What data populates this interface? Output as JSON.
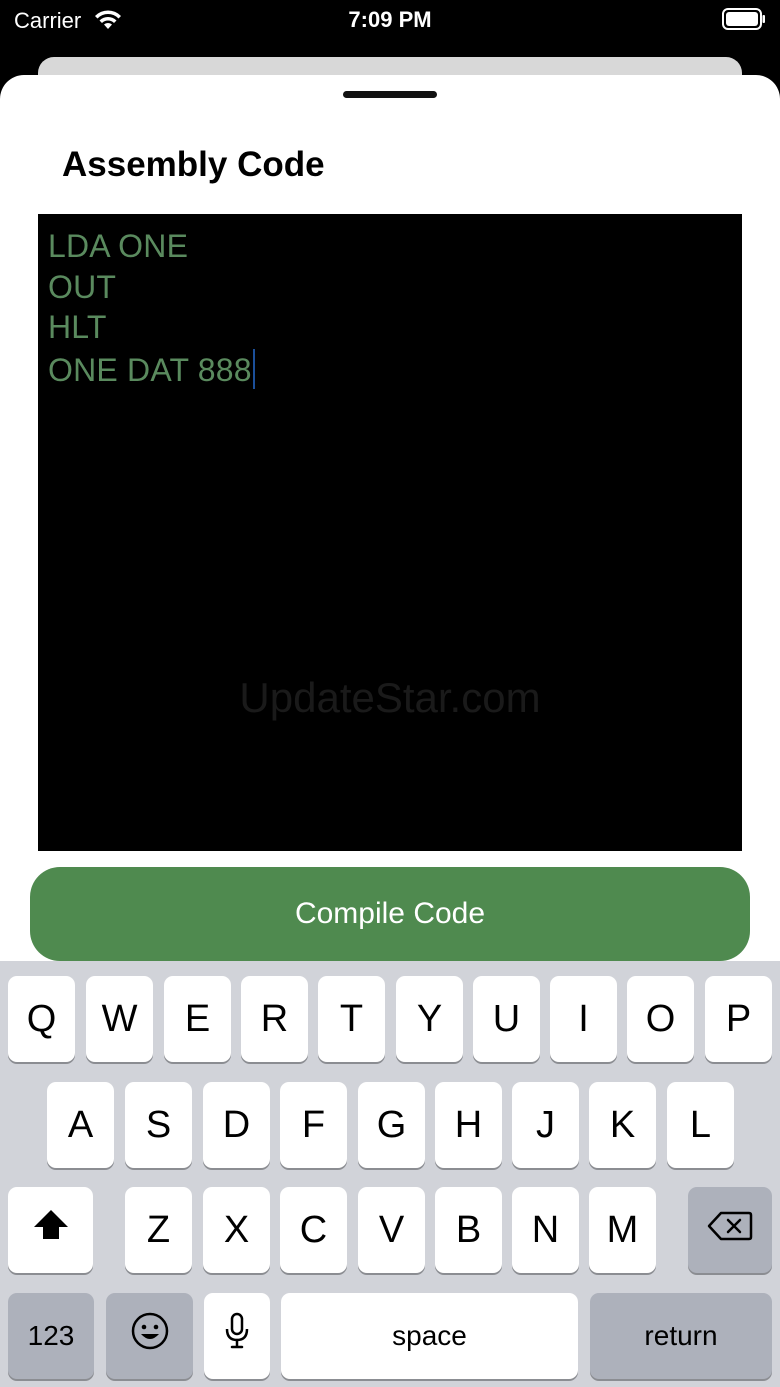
{
  "status_bar": {
    "carrier": "Carrier",
    "time": "7:09 PM"
  },
  "sheet": {
    "title": "Assembly Code"
  },
  "editor": {
    "lines": [
      "LDA ONE",
      "OUT",
      "HLT",
      "ONE DAT 888"
    ],
    "watermark": "UpdateStar.com",
    "text_color": "#5a8a5e",
    "background": "#000000"
  },
  "compile_button": {
    "label": "Compile Code",
    "color": "#4f8a4f"
  },
  "keyboard": {
    "row1": [
      "Q",
      "W",
      "E",
      "R",
      "T",
      "Y",
      "U",
      "I",
      "O",
      "P"
    ],
    "row2": [
      "A",
      "S",
      "D",
      "F",
      "G",
      "H",
      "J",
      "K",
      "L"
    ],
    "row3": [
      "Z",
      "X",
      "C",
      "V",
      "B",
      "N",
      "M"
    ],
    "numbers_key": "123",
    "space_key": "space",
    "return_key": "return",
    "icons": {
      "shift": "shift-arrow-icon",
      "delete": "backspace-icon",
      "emoji": "emoji-face-icon",
      "mic": "microphone-icon"
    }
  }
}
